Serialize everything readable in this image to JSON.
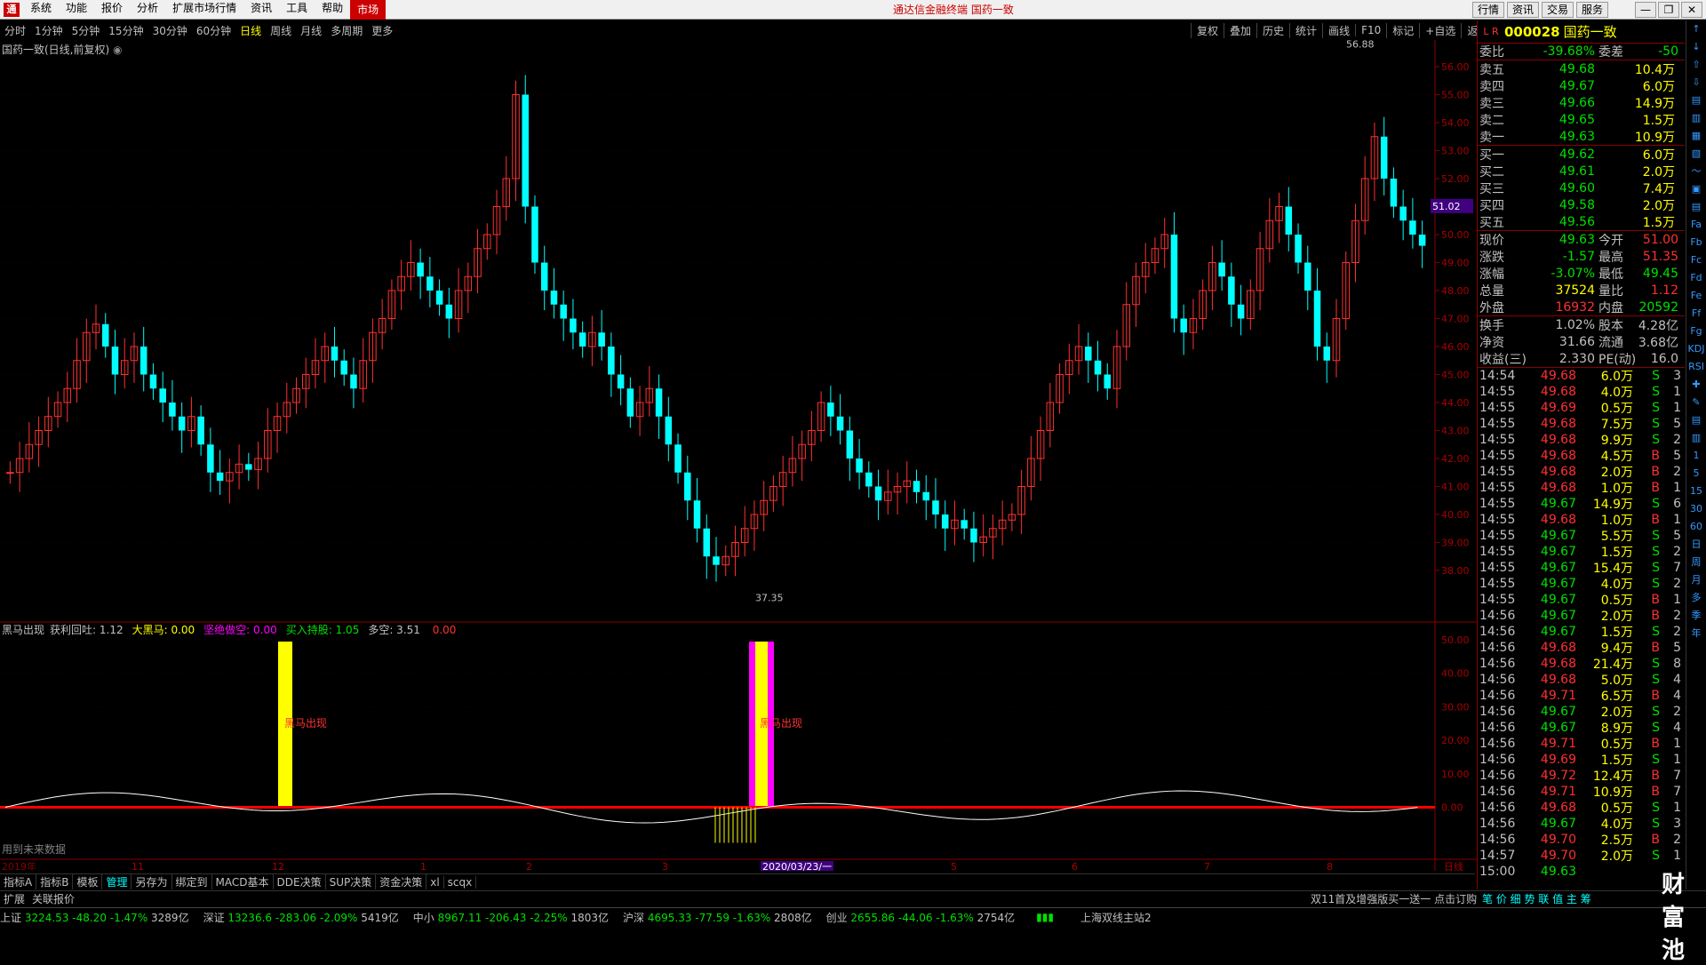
{
  "menubar": {
    "items": [
      "系统",
      "功能",
      "报价",
      "分析",
      "扩展市场行情",
      "资讯",
      "工具",
      "帮助",
      "市场"
    ],
    "center_title": "通达信金融终端  国药一致",
    "right_buttons": [
      "行情",
      "资讯",
      "交易",
      "服务"
    ]
  },
  "periods": [
    "分时",
    "1分钟",
    "5分钟",
    "15分钟",
    "30分钟",
    "60分钟",
    "日线",
    "周线",
    "月线",
    "多周期",
    "更多"
  ],
  "period_selected": "日线",
  "toolbar2": [
    "复权",
    "叠加",
    "历史",
    "统计",
    "画线",
    "F10",
    "标记",
    "+自选",
    "返回"
  ],
  "main_label": "国药一致(日线,前复权)",
  "indicator": {
    "name": "黑马出现",
    "items": [
      {
        "label": "获利回吐:",
        "value": "1.12",
        "color": "#c0c0c0"
      },
      {
        "label": "大黑马:",
        "value": "0.00",
        "color": "#ffff00"
      },
      {
        "label": "坚绝做空:",
        "value": "0.00",
        "color": "#ff00ff"
      },
      {
        "label": "买入持股:",
        "value": "1.05",
        "color": "#00e000"
      },
      {
        "label": "多空:",
        "value": "3.51",
        "color": "#c0c0c0"
      },
      {
        "label": "",
        "value": "0.00",
        "color": "#ff3030"
      }
    ],
    "signal_text": "黑马出现",
    "future_note": "用到未来数据"
  },
  "price_axis": [
    "56.00",
    "55.00",
    "54.00",
    "53.00",
    "52.00",
    "51.00",
    "50.00",
    "49.00",
    "48.00",
    "47.00",
    "46.00",
    "45.00",
    "44.00",
    "43.00",
    "42.00",
    "41.00",
    "40.00",
    "39.00",
    "38.00"
  ],
  "current_price_tag": "51.02",
  "high_label": "56.88",
  "low_label": "37.35",
  "ind_axis": [
    "50.00",
    "40.00",
    "30.00",
    "20.00",
    "10.00",
    "0.00"
  ],
  "x_axis": [
    "2019年",
    "11",
    "12",
    "1",
    "2",
    "3",
    "2020/03/23/一",
    "5",
    "6",
    "7",
    "8",
    "日线"
  ],
  "bottom_tabs": [
    "指标A",
    "指标B",
    "模板",
    "管理",
    "另存为",
    "绑定到",
    "MACD基本",
    "DDE决策",
    "SUP决策",
    "资金决策",
    "xl",
    "scqx"
  ],
  "bottom_tab_selected": "管理",
  "statusbar1": {
    "left": "扩展",
    "left2": "关联报价",
    "ad": "双11首及增强版买一送一 点击订购",
    "right": "笔 价 细 势 联 值 主 筹"
  },
  "statusbar2": [
    {
      "name": "上证",
      "price": "3224.53",
      "chg": "-48.20",
      "pct": "-1.47%",
      "amt": "3289亿"
    },
    {
      "name": "深证",
      "price": "13236.6",
      "chg": "-283.06",
      "pct": "-2.09%",
      "amt": "5419亿"
    },
    {
      "name": "中小",
      "price": "8967.11",
      "chg": "-206.43",
      "pct": "-2.25%",
      "amt": "1803亿"
    },
    {
      "name": "沪深",
      "price": "4695.33",
      "chg": "-77.59",
      "pct": "-1.63%",
      "amt": "2808亿"
    },
    {
      "name": "创业",
      "price": "2655.86",
      "chg": "-44.06",
      "pct": "-1.63%",
      "amt": "2754亿"
    }
  ],
  "server": "上海双线主站2",
  "stock": {
    "badge": "L R",
    "code": "000028",
    "name": "国药一致"
  },
  "weibi": {
    "label1": "委比",
    "val1": "-39.68%",
    "label2": "委差",
    "val2": "-50"
  },
  "sells": [
    {
      "label": "卖五",
      "price": "49.68",
      "vol": "10.4万"
    },
    {
      "label": "卖四",
      "price": "49.67",
      "vol": "6.0万"
    },
    {
      "label": "卖三",
      "price": "49.66",
      "vol": "14.9万"
    },
    {
      "label": "卖二",
      "price": "49.65",
      "vol": "1.5万"
    },
    {
      "label": "卖一",
      "price": "49.63",
      "vol": "10.9万"
    }
  ],
  "buys": [
    {
      "label": "买一",
      "price": "49.62",
      "vol": "6.0万"
    },
    {
      "label": "买二",
      "price": "49.61",
      "vol": "2.0万"
    },
    {
      "label": "买三",
      "price": "49.60",
      "vol": "7.4万"
    },
    {
      "label": "买四",
      "price": "49.58",
      "vol": "2.0万"
    },
    {
      "label": "买五",
      "price": "49.56",
      "vol": "1.5万"
    }
  ],
  "quote": [
    {
      "l1": "现价",
      "v1": "49.63",
      "c1": "#00e000",
      "l2": "今开",
      "v2": "51.00",
      "c2": "#ff3030"
    },
    {
      "l1": "涨跌",
      "v1": "-1.57",
      "c1": "#00e000",
      "l2": "最高",
      "v2": "51.35",
      "c2": "#ff3030"
    },
    {
      "l1": "涨幅",
      "v1": "-3.07%",
      "c1": "#00e000",
      "l2": "最低",
      "v2": "49.45",
      "c2": "#00e000"
    },
    {
      "l1": "总量",
      "v1": "37524",
      "c1": "#ffff00",
      "l2": "量比",
      "v2": "1.12",
      "c2": "#ff3030"
    },
    {
      "l1": "外盘",
      "v1": "16932",
      "c1": "#ff3030",
      "l2": "内盘",
      "v2": "20592",
      "c2": "#00e000"
    }
  ],
  "quote2": [
    {
      "l1": "换手",
      "v1": "1.02%",
      "l2": "股本",
      "v2": "4.28亿"
    },
    {
      "l1": "净资",
      "v1": "31.66",
      "l2": "流通",
      "v2": "3.68亿"
    },
    {
      "l1": "收益(三)",
      "v1": "2.330",
      "l2": "PE(动)",
      "v2": "16.0"
    }
  ],
  "ticks": [
    [
      "14:54",
      "49.68",
      "6.0万",
      "S",
      "3"
    ],
    [
      "14:55",
      "49.68",
      "4.0万",
      "S",
      "1"
    ],
    [
      "14:55",
      "49.69",
      "0.5万",
      "S",
      "1"
    ],
    [
      "14:55",
      "49.68",
      "7.5万",
      "S",
      "5"
    ],
    [
      "14:55",
      "49.68",
      "9.9万",
      "S",
      "2"
    ],
    [
      "14:55",
      "49.68",
      "4.5万",
      "B",
      "5"
    ],
    [
      "14:55",
      "49.68",
      "2.0万",
      "B",
      "2"
    ],
    [
      "14:55",
      "49.68",
      "1.0万",
      "B",
      "1"
    ],
    [
      "14:55",
      "49.67",
      "14.9万",
      "S",
      "6"
    ],
    [
      "14:55",
      "49.68",
      "1.0万",
      "B",
      "1"
    ],
    [
      "14:55",
      "49.67",
      "5.5万",
      "S",
      "5"
    ],
    [
      "14:55",
      "49.67",
      "1.5万",
      "S",
      "2"
    ],
    [
      "14:55",
      "49.67",
      "15.4万",
      "S",
      "7"
    ],
    [
      "14:55",
      "49.67",
      "4.0万",
      "S",
      "2"
    ],
    [
      "14:55",
      "49.67",
      "0.5万",
      "B",
      "1"
    ],
    [
      "14:56",
      "49.67",
      "2.0万",
      "B",
      "2"
    ],
    [
      "14:56",
      "49.67",
      "1.5万",
      "S",
      "2"
    ],
    [
      "14:56",
      "49.68",
      "9.4万",
      "B",
      "5"
    ],
    [
      "14:56",
      "49.68",
      "21.4万",
      "S",
      "8"
    ],
    [
      "14:56",
      "49.68",
      "5.0万",
      "S",
      "4"
    ],
    [
      "14:56",
      "49.71",
      "6.5万",
      "B",
      "4"
    ],
    [
      "14:56",
      "49.67",
      "2.0万",
      "S",
      "2"
    ],
    [
      "14:56",
      "49.67",
      "8.9万",
      "S",
      "4"
    ],
    [
      "14:56",
      "49.71",
      "0.5万",
      "B",
      "1"
    ],
    [
      "14:56",
      "49.69",
      "1.5万",
      "S",
      "1"
    ],
    [
      "14:56",
      "49.72",
      "12.4万",
      "B",
      "7"
    ],
    [
      "14:56",
      "49.71",
      "10.9万",
      "B",
      "7"
    ],
    [
      "14:56",
      "49.68",
      "0.5万",
      "S",
      "1"
    ],
    [
      "14:56",
      "49.67",
      "4.0万",
      "S",
      "3"
    ],
    [
      "14:56",
      "49.70",
      "2.5万",
      "B",
      "2"
    ],
    [
      "14:57",
      "49.70",
      "2.0万",
      "S",
      "1"
    ],
    [
      "15:00",
      "49.63",
      "",
      "",
      ""
    ]
  ],
  "side_tools": [
    "↑",
    "↓",
    "⇧",
    "⇩",
    "▤",
    "▥",
    "▦",
    "▧",
    "〜",
    "▣",
    "▤",
    "Fa",
    "Fb",
    "Fc",
    "Fd",
    "Fe",
    "Ff",
    "Fg",
    "KDJ",
    "RSI",
    "✚",
    "✎",
    "▤",
    "▥",
    "1",
    "5",
    "15",
    "30",
    "60",
    "日",
    "周",
    "月",
    "多",
    "季",
    "年"
  ],
  "watermark": "财富池"
}
